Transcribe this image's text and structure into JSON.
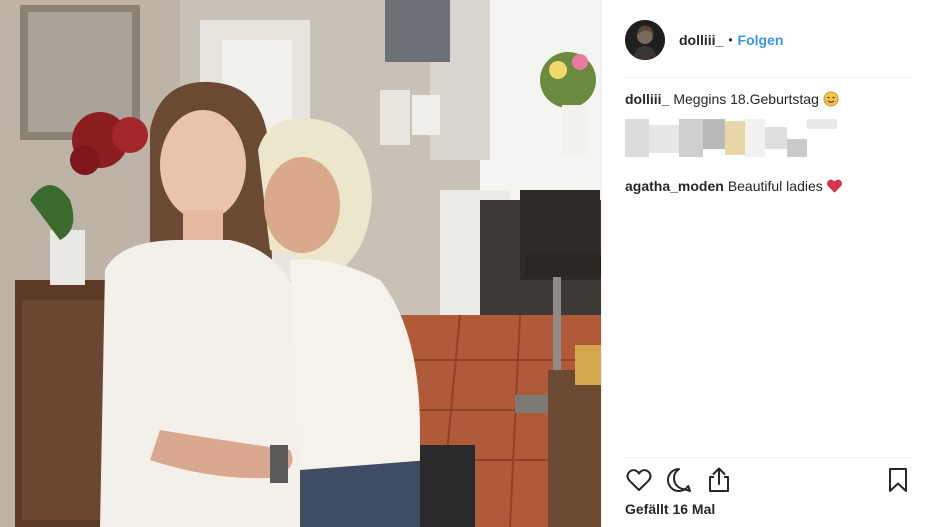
{
  "post": {
    "username": "dolliii_",
    "separator": "•",
    "follow_label": "Folgen",
    "caption": {
      "user": "dolliii_",
      "text": "Meggins 18.Geburtstag",
      "emoji_icon": "smiling-face-icon"
    },
    "comments": [
      {
        "user": "agatha_moden",
        "text": "Beautiful ladies",
        "emoji_icon": "heart-icon"
      }
    ],
    "likes_label": "Gefällt 16 Mal"
  },
  "icons": {
    "like": "heart-outline-icon",
    "comment": "speech-bubble-icon",
    "share": "share-upload-icon",
    "save": "bookmark-icon"
  },
  "colors": {
    "link": "#3897f0",
    "text": "#262626",
    "divider": "#efefef",
    "heart_emoji": "#e0334d"
  }
}
